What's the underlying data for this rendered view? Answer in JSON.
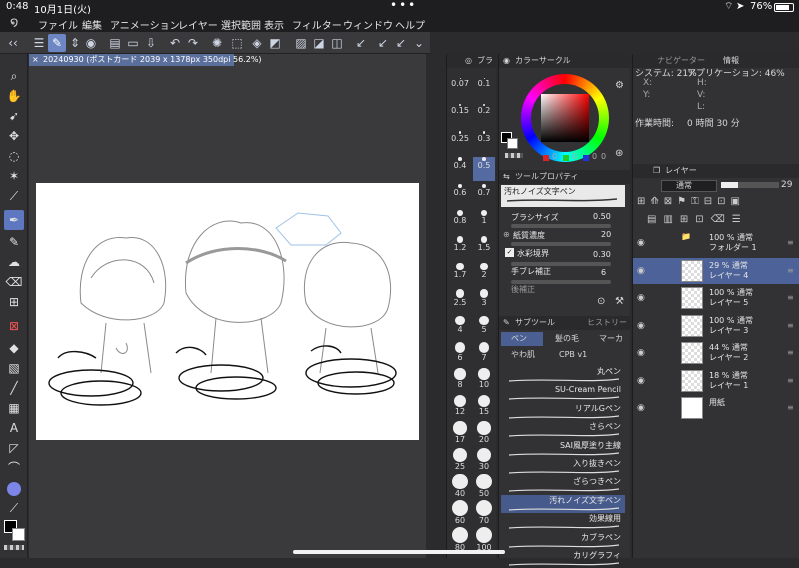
{
  "status": {
    "time": "0:48",
    "date": "10月1日(火)",
    "battery": "76%"
  },
  "menu": [
    "ファイル",
    "編集",
    "アニメーション",
    "レイヤー",
    "選択範囲",
    "表示",
    "フィルター",
    "ウィンドウ",
    "ヘルプ"
  ],
  "document": {
    "tab_title": "20240930 (ポストカード 2039 x 1378px 350dpi 56.2%)"
  },
  "brush_sizes": [
    "0.07",
    "0.1",
    "0.15",
    "0.2",
    "0.25",
    "0.3",
    "0.4",
    "0.5",
    "0.6",
    "0.7",
    "0.8",
    "1",
    "1.2",
    "1.5",
    "1.7",
    "2",
    "2.5",
    "3",
    "4",
    "5",
    "6",
    "7",
    "8",
    "10",
    "12",
    "15",
    "17",
    "20",
    "25",
    "30",
    "40",
    "50",
    "60",
    "70",
    "80",
    "100"
  ],
  "brush_panel_tab": "ブラ",
  "color_panel": {
    "title": "カラーサークル",
    "values": [
      "0",
      "0",
      "0",
      "0"
    ]
  },
  "tool_property": {
    "title": "ツールプロパティ",
    "brush_name": "汚れノイズ文字ペン",
    "items": [
      {
        "label": "ブラシサイズ",
        "value": "0.50"
      },
      {
        "label": "紙質濃度",
        "value": "20"
      },
      {
        "label": "水彩境界",
        "value": "0.30"
      },
      {
        "label": "手ブレ補正",
        "value": "6"
      },
      {
        "label": "後補正",
        "value": ""
      }
    ]
  },
  "subtool": {
    "title": "サブツール",
    "tab2": "ヒストリー",
    "tabs": [
      "ペン",
      "髪の毛",
      "マーカ"
    ],
    "groups": [
      "やわ肌",
      "CPB v1"
    ],
    "brushes": [
      "丸ペン",
      "SU-Cream Pencil",
      "リアルGペン",
      "さらペン",
      "SAI風厚塗り主線",
      "入り抜きペン",
      "ざらつきペン",
      "汚れノイズ文字ペン",
      "効果線用",
      "カブラペン",
      "カリグラフィ"
    ]
  },
  "navigator": {
    "tab": "ナビゲーター",
    "tab2": "情報",
    "system": "システム: 21%",
    "app": "アプリケーション: 46%",
    "worktime_label": "作業時間:",
    "worktime": "0 時間 30 分",
    "x": "X:",
    "y": "Y:",
    "h": "H:",
    "v": "V:",
    "l": "L:"
  },
  "layer_panel": {
    "title": "レイヤー",
    "blend": "通常",
    "opacity": "29",
    "layers": [
      {
        "percent": "100 % 通常",
        "name": "フォルダー 1"
      },
      {
        "percent": "29 % 通常",
        "name": "レイヤー 4"
      },
      {
        "percent": "100 % 通常",
        "name": "レイヤー 5"
      },
      {
        "percent": "100 % 通常",
        "name": "レイヤー 3"
      },
      {
        "percent": "44 % 通常",
        "name": "レイヤー 2"
      },
      {
        "percent": "18 % 通常",
        "name": "レイヤー 1"
      },
      {
        "percent": "",
        "name": "用紙"
      }
    ]
  },
  "colors": {
    "accent": "#5d78c0",
    "panel": "#323235",
    "main_color": "#000000"
  }
}
